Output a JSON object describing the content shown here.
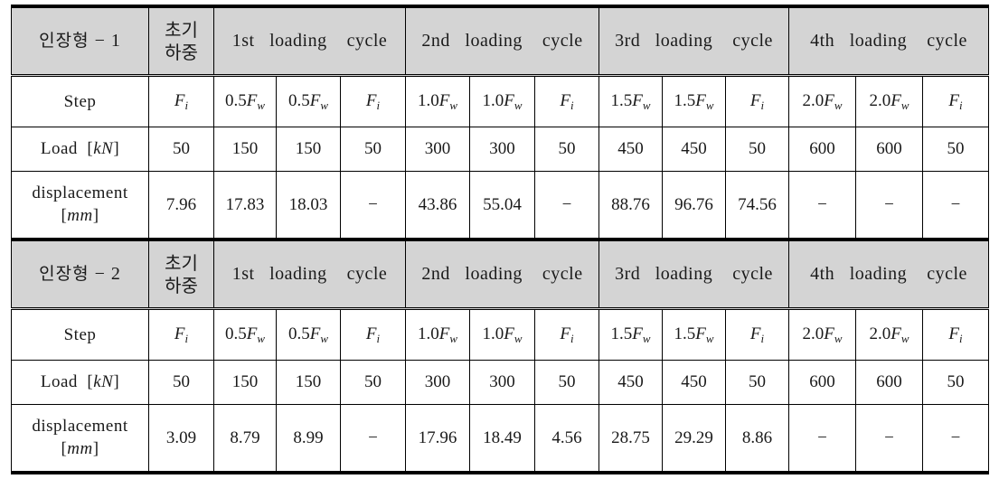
{
  "document": {
    "kind": "two-block-test-result-table",
    "header_background": "#d4d4d4",
    "border_color": "#000000"
  },
  "row_labels": {
    "step": "Step",
    "load_main": "Load",
    "load_unit": "[kN]",
    "disp_main": "displacement",
    "disp_unit": "[mm]"
  },
  "column_groups": {
    "initial_load": {
      "line1": "초기",
      "line2": "하중"
    },
    "cycles": [
      "1st  loading  cycle",
      "2nd  loading  cycle",
      "3rd  loading  cycle",
      "4th  loading  cycle"
    ],
    "cycle_ordinals": [
      "1st",
      "2nd",
      "3rd",
      "4th"
    ],
    "cycle_suffix": "loading  cycle"
  },
  "blocks": [
    {
      "title": "인장형 − 1",
      "title_prefix": "인장형",
      "title_dash": "−",
      "title_index": "1",
      "step": [
        "Fi",
        "0.5Fw",
        "0.5Fw",
        "Fi",
        "1.0Fw",
        "1.0Fw",
        "Fi",
        "1.5Fw",
        "1.5Fw",
        "Fi",
        "2.0Fw",
        "2.0Fw",
        "Fi"
      ],
      "step_display": [
        {
          "coef": "",
          "base": "F",
          "sub": "i"
        },
        {
          "coef": "0.5",
          "base": "F",
          "sub": "w"
        },
        {
          "coef": "0.5",
          "base": "F",
          "sub": "w"
        },
        {
          "coef": "",
          "base": "F",
          "sub": "i"
        },
        {
          "coef": "1.0",
          "base": "F",
          "sub": "w"
        },
        {
          "coef": "1.0",
          "base": "F",
          "sub": "w"
        },
        {
          "coef": "",
          "base": "F",
          "sub": "i"
        },
        {
          "coef": "1.5",
          "base": "F",
          "sub": "w"
        },
        {
          "coef": "1.5",
          "base": "F",
          "sub": "w"
        },
        {
          "coef": "",
          "base": "F",
          "sub": "i"
        },
        {
          "coef": "2.0",
          "base": "F",
          "sub": "w"
        },
        {
          "coef": "2.0",
          "base": "F",
          "sub": "w"
        },
        {
          "coef": "",
          "base": "F",
          "sub": "i"
        }
      ],
      "load": [
        "50",
        "150",
        "150",
        "50",
        "300",
        "300",
        "50",
        "450",
        "450",
        "50",
        "600",
        "600",
        "50"
      ],
      "displacement": [
        "7.96",
        "17.83",
        "18.03",
        "−",
        "43.86",
        "55.04",
        "−",
        "88.76",
        "96.76",
        "74.56",
        "−",
        "−",
        "−"
      ]
    },
    {
      "title": "인장형 − 2",
      "title_prefix": "인장형",
      "title_dash": "−",
      "title_index": "2",
      "step": [
        "Fi",
        "0.5Fw",
        "0.5Fw",
        "Fi",
        "1.0Fw",
        "1.0Fw",
        "Fi",
        "1.5Fw",
        "1.5Fw",
        "Fi",
        "2.0Fw",
        "2.0Fw",
        "Fi"
      ],
      "step_display": [
        {
          "coef": "",
          "base": "F",
          "sub": "i"
        },
        {
          "coef": "0.5",
          "base": "F",
          "sub": "w"
        },
        {
          "coef": "0.5",
          "base": "F",
          "sub": "w"
        },
        {
          "coef": "",
          "base": "F",
          "sub": "i"
        },
        {
          "coef": "1.0",
          "base": "F",
          "sub": "w"
        },
        {
          "coef": "1.0",
          "base": "F",
          "sub": "w"
        },
        {
          "coef": "",
          "base": "F",
          "sub": "i"
        },
        {
          "coef": "1.5",
          "base": "F",
          "sub": "w"
        },
        {
          "coef": "1.5",
          "base": "F",
          "sub": "w"
        },
        {
          "coef": "",
          "base": "F",
          "sub": "i"
        },
        {
          "coef": "2.0",
          "base": "F",
          "sub": "w"
        },
        {
          "coef": "2.0",
          "base": "F",
          "sub": "w"
        },
        {
          "coef": "",
          "base": "F",
          "sub": "i"
        }
      ],
      "load": [
        "50",
        "150",
        "150",
        "50",
        "300",
        "300",
        "50",
        "450",
        "450",
        "50",
        "600",
        "600",
        "50"
      ],
      "displacement": [
        "3.09",
        "8.79",
        "8.99",
        "−",
        "17.96",
        "18.49",
        "4.56",
        "28.75",
        "29.29",
        "8.86",
        "−",
        "−",
        "−"
      ]
    }
  ]
}
